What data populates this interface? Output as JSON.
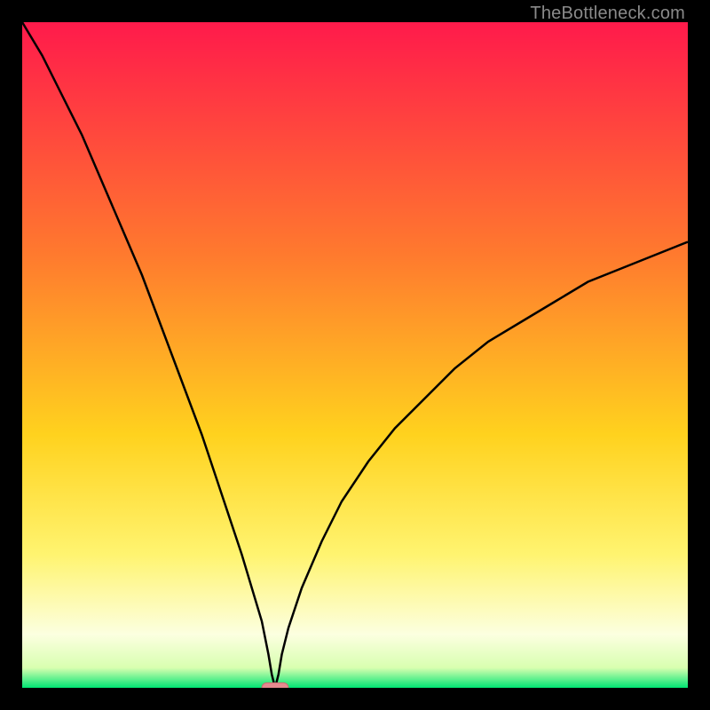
{
  "watermark": "TheBottleneck.com",
  "colors": {
    "top": "#ff1a4b",
    "upper_mid": "#ff7a2e",
    "mid": "#ffd21e",
    "lower_mid": "#fff470",
    "pale": "#fcffe0",
    "green": "#00e573",
    "curve": "#000000",
    "marker_fill": "#e58a8f",
    "marker_stroke": "#cc6a70",
    "background": "#000000"
  },
  "chart_data": {
    "type": "line",
    "title": "",
    "xlabel": "",
    "ylabel": "",
    "xlim": [
      0,
      100
    ],
    "ylim": [
      0,
      100
    ],
    "grid": false,
    "legend": false,
    "x_at_min": 38,
    "marker": {
      "x": 38,
      "y": 0,
      "width_pct": 4,
      "height_pct": 1.5
    },
    "series": [
      {
        "name": "left-branch",
        "x": [
          0,
          3,
          6,
          9,
          12,
          15,
          18,
          21,
          24,
          27,
          30,
          33,
          36,
          37,
          37.5,
          38
        ],
        "values": [
          100,
          95,
          89,
          83,
          76,
          69,
          62,
          54,
          46,
          38,
          29,
          20,
          10,
          5,
          2,
          0
        ]
      },
      {
        "name": "right-branch",
        "x": [
          38,
          38.5,
          39,
          40,
          42,
          45,
          48,
          52,
          56,
          60,
          65,
          70,
          75,
          80,
          85,
          90,
          95,
          100
        ],
        "values": [
          0,
          2,
          5,
          9,
          15,
          22,
          28,
          34,
          39,
          43,
          48,
          52,
          55,
          58,
          61,
          63,
          65,
          67
        ]
      }
    ],
    "gradient_bands_pct_from_top": [
      {
        "stop": 0,
        "color": "#ff1a4b"
      },
      {
        "stop": 35,
        "color": "#ff7a2e"
      },
      {
        "stop": 62,
        "color": "#ffd21e"
      },
      {
        "stop": 80,
        "color": "#fff470"
      },
      {
        "stop": 92,
        "color": "#fcffe0"
      },
      {
        "stop": 97,
        "color": "#d8ffb0"
      },
      {
        "stop": 100,
        "color": "#00e573"
      }
    ]
  }
}
